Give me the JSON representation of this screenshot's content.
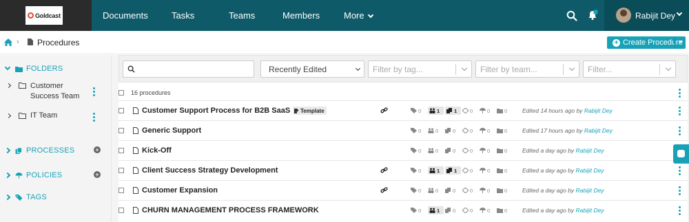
{
  "brand": {
    "name": "Goldcast"
  },
  "nav": {
    "items": [
      "Documents",
      "Tasks",
      "Teams",
      "Members",
      "More"
    ]
  },
  "user": {
    "name": "Rabijit Dey"
  },
  "breadcrumb": {
    "current": "Procedures"
  },
  "create_button": {
    "label": "Create Procedure"
  },
  "sidebar": {
    "folders_label": "FOLDERS",
    "folders": [
      {
        "line1": "Customer",
        "line2": "Success Team"
      },
      {
        "line1": "IT Team",
        "line2": ""
      }
    ],
    "processes_label": "PROCESSES",
    "policies_label": "POLICIES",
    "tags_label": "TAGS"
  },
  "filters": {
    "search_placeholder": "",
    "sort_selected": "Recently Edited",
    "tag_placeholder": "Filter by tag...",
    "team_placeholder": "Filter by team...",
    "filter_placeholder": "Filter..."
  },
  "list": {
    "count_label": "16 procedures",
    "template_badge": "Template",
    "rows": [
      {
        "title": "Customer Support Process for B2B SaaS",
        "template": true,
        "link": true,
        "stats": [
          "0",
          "1",
          "1",
          "0",
          "0",
          "0"
        ],
        "active": [
          false,
          true,
          true,
          false,
          false,
          false
        ],
        "edited": "Edited 14 hours ago by",
        "by": "Rabijit Dey"
      },
      {
        "title": "Generic Support",
        "template": false,
        "link": false,
        "stats": [
          "0",
          "0",
          "0",
          "0",
          "0",
          "0"
        ],
        "active": [
          false,
          false,
          false,
          false,
          false,
          false
        ],
        "edited": "Edited 17 hours ago by",
        "by": "Rabijit Dey"
      },
      {
        "title": "Kick-Off",
        "template": false,
        "link": false,
        "stats": [
          "0",
          "0",
          "0",
          "0",
          "0",
          "0"
        ],
        "active": [
          false,
          false,
          false,
          false,
          false,
          false
        ],
        "edited": "Edited a day ago by",
        "by": "Rabijit Dey"
      },
      {
        "title": "Client Success Strategy Development",
        "template": false,
        "link": true,
        "stats": [
          "0",
          "1",
          "1",
          "0",
          "0",
          "0"
        ],
        "active": [
          false,
          true,
          true,
          false,
          false,
          false
        ],
        "edited": "Edited a day ago by",
        "by": "Rabijit Dey"
      },
      {
        "title": "Customer Expansion",
        "template": false,
        "link": true,
        "stats": [
          "0",
          "0",
          "0",
          "0",
          "0",
          "0"
        ],
        "active": [
          false,
          false,
          false,
          false,
          false,
          false
        ],
        "edited": "Edited a day ago by",
        "by": "Rabijit Dey"
      },
      {
        "title": "CHURN MANAGEMENT PROCESS FRAMEWORK",
        "template": false,
        "link": false,
        "stats": [
          "0",
          "1",
          "0",
          "0",
          "0",
          "0"
        ],
        "active": [
          false,
          true,
          false,
          false,
          false,
          false
        ],
        "edited": "Edited a day ago by",
        "by": "Rabijit Dey"
      }
    ]
  },
  "colors": {
    "nav": "#0f5a69",
    "accent": "#17a2b8",
    "sidebar": "#f4f4f4"
  },
  "icons": [
    "home-icon",
    "document-icon",
    "search-icon",
    "bell-icon",
    "folder-icon",
    "link-icon",
    "tag-icon",
    "team-icon",
    "copy-icon",
    "kebab-icon"
  ]
}
